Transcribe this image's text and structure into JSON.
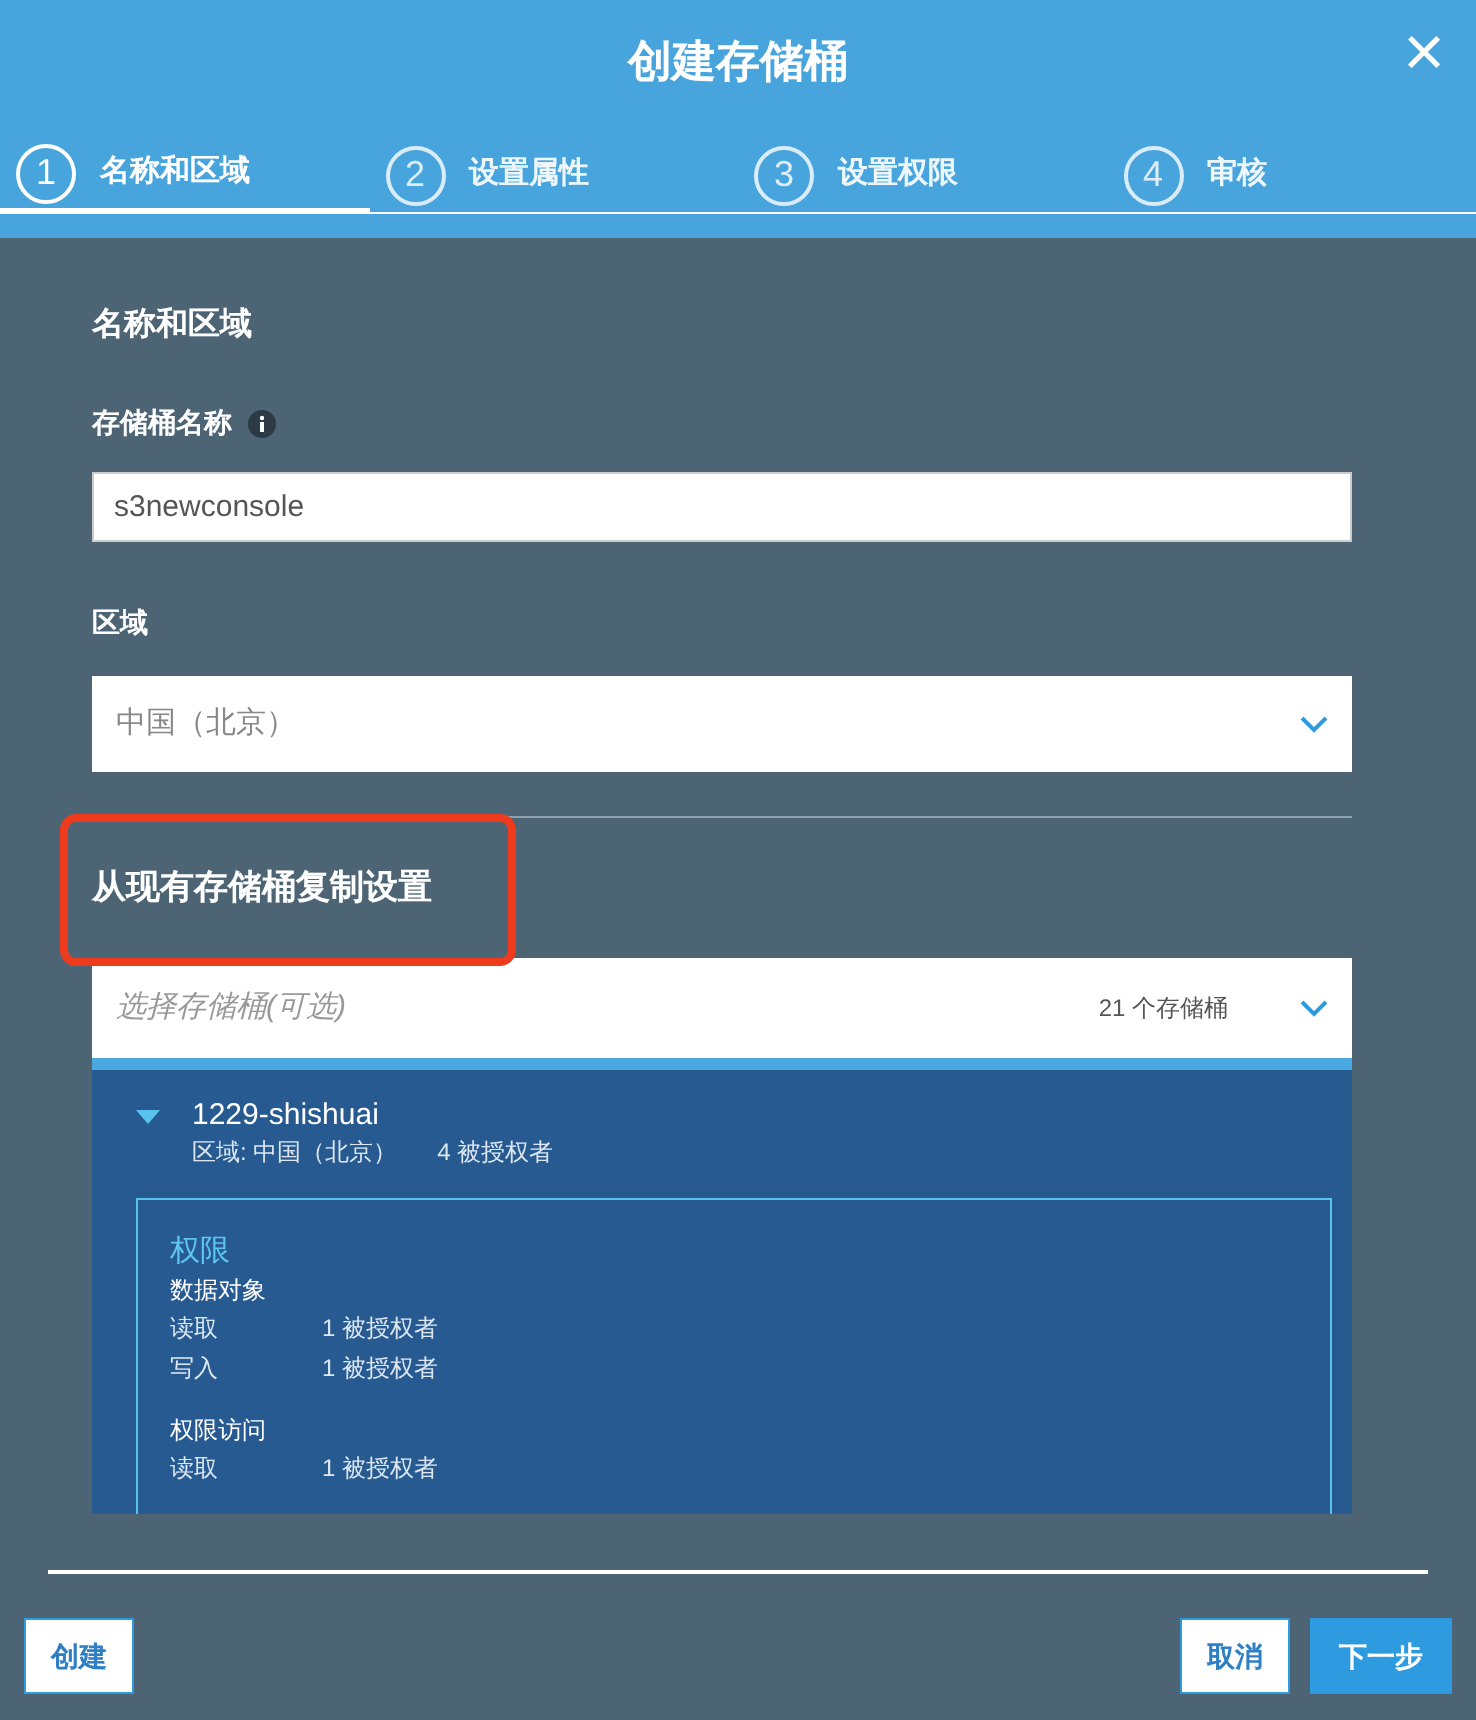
{
  "window": {
    "title": "创建存储桶",
    "close": "×"
  },
  "steps": [
    {
      "number": "1",
      "label": "名称和区域",
      "selected": true
    },
    {
      "number": "2",
      "label": "设置属性",
      "selected": false
    },
    {
      "number": "3",
      "label": "设置权限",
      "selected": false
    },
    {
      "number": "4",
      "label": "审核",
      "selected": false
    }
  ],
  "section_title": "名称和区域",
  "bucket_name": {
    "label": "存储桶名称",
    "value": "s3newconsole"
  },
  "region": {
    "label": "区域",
    "value": "中国（北京）"
  },
  "copy_settings": {
    "title": "从现有存储桶复制设置",
    "highlighted": true,
    "select": {
      "placeholder": "选择存储桶(可选)",
      "count": "21 个存储桶",
      "expanded": true
    },
    "bucket": {
      "name": "1229-shishuai",
      "region": "区域: 中国（北京）",
      "grantees": "4 被授权者",
      "permissions": {
        "title": "权限",
        "groups": [
          {
            "title": "数据对象",
            "rows": [
              {
                "label": "读取",
                "value": "1 被授权者"
              },
              {
                "label": "写入",
                "value": "1 被授权者"
              }
            ]
          },
          {
            "title": "权限访问",
            "rows": [
              {
                "label": "读取",
                "value": "1 被授权者"
              }
            ]
          }
        ]
      }
    }
  },
  "buttons": {
    "create": "创建",
    "cancel": "取消",
    "next": "下一步"
  }
}
